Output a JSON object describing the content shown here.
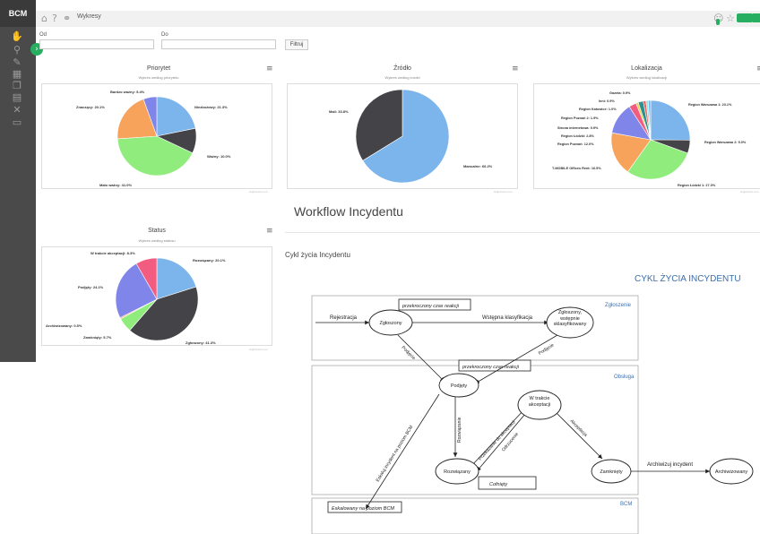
{
  "app": {
    "logo": "BCM"
  },
  "topbar": {
    "breadcrumb": "Wykresy"
  },
  "filters": {
    "from_label": "Od",
    "to_label": "Do",
    "filter_button": "Filtruj"
  },
  "credit": "Highcharts.com",
  "charts": {
    "priorytet": {
      "title": "Priorytet",
      "subtitle": "Wykres według priorytetu"
    },
    "zrodlo": {
      "title": "Źródło",
      "subtitle": "Wykres według źródeł"
    },
    "lokalizacja": {
      "title": "Lokalizacja",
      "subtitle": "Wykres według lokalizacji"
    },
    "status": {
      "title": "Status",
      "subtitle": "Wykres według statusu"
    }
  },
  "chart_data": [
    {
      "type": "pie",
      "title": "Priorytet",
      "subtitle": "Wykres według priorytetu",
      "series": [
        {
          "name": "Priorytet",
          "values": [
            {
              "label": "Niezbożowy: 21.3%",
              "value": 21.3,
              "color": "#7cb5ec"
            },
            {
              "label": "Ważny: 10.0%",
              "value": 10.0,
              "color": "#434348"
            },
            {
              "label": "Mało ważny: 41.0%",
              "value": 41.0,
              "color": "#90ed7d"
            },
            {
              "label": "Znaczący: 20.1%",
              "value": 20.1,
              "color": "#f7a35c"
            },
            {
              "label": "Bardzo ważny: 5.4%",
              "value": 5.4,
              "color": "#8085e9"
            }
          ]
        }
      ]
    },
    {
      "type": "pie",
      "title": "Źródło",
      "subtitle": "Wykres według źródeł",
      "series": [
        {
          "name": "Źródło",
          "values": [
            {
              "label": "Manualne: 66.2%",
              "value": 66.2,
              "color": "#7cb5ec"
            },
            {
              "label": "Mail: 33.8%",
              "value": 33.8,
              "color": "#434348"
            }
          ]
        }
      ]
    },
    {
      "type": "pie",
      "title": "Lokalizacja",
      "subtitle": "Wykres według lokalizacji",
      "series": [
        {
          "name": "Lokalizacja",
          "values": [
            {
              "label": "Region Warszawa 1: 23.1%",
              "value": 23.1,
              "color": "#7cb5ec"
            },
            {
              "label": "Region Warszawa 2: 5.0%",
              "value": 5.0,
              "color": "#434348"
            },
            {
              "label": "Region Łódzki 1: 27.0%",
              "value": 27.0,
              "color": "#90ed7d"
            },
            {
              "label": "T-MOBILE Offices Rent: 16.5%",
              "value": 16.5,
              "color": "#f7a35c"
            },
            {
              "label": "Region Poznań: 12.0%",
              "value": 12.0,
              "color": "#8085e9"
            },
            {
              "label": "Region Łódzki: 2.8%",
              "value": 2.8,
              "color": "#f15c80"
            },
            {
              "label": "Strona internetowa: 0.9%",
              "value": 0.9,
              "color": "#e4d354"
            },
            {
              "label": "Region Poznań 2: 1.9%",
              "value": 1.9,
              "color": "#2b908f"
            },
            {
              "label": "Region Katowice: 1.0%",
              "value": 1.0,
              "color": "#f45b5b"
            },
            {
              "label": "Inni: 0.9%",
              "value": 0.9,
              "color": "#91e8e1"
            },
            {
              "label": "Gazeta: 0.9%",
              "value": 0.9,
              "color": "#7cb5ec"
            }
          ]
        }
      ]
    },
    {
      "type": "pie",
      "title": "Status",
      "subtitle": "Wykres według statusu",
      "series": [
        {
          "name": "Status",
          "values": [
            {
              "label": "Rozwiązany: 20.1%",
              "value": 20.1,
              "color": "#7cb5ec"
            },
            {
              "label": "Zgłoszony: 41.3%",
              "value": 41.3,
              "color": "#434348"
            },
            {
              "label": "Zamknięty: 5.7%",
              "value": 5.7,
              "color": "#90ed7d"
            },
            {
              "label": "Archiwizowany: 0.5%",
              "value": 0.5,
              "color": "#f7a35c"
            },
            {
              "label": "Podjęty: 24.1%",
              "value": 24.1,
              "color": "#8085e9"
            },
            {
              "label": "W trakcie akceptacji: 8.3%",
              "value": 8.3,
              "color": "#f15c80"
            }
          ]
        }
      ]
    }
  ],
  "workflow": {
    "title": "Workflow Incydentu",
    "subtitle": "Cykl życia Incydentu",
    "diagram_title": "CYKL ŻYCIA INCYDENTU",
    "lanes": {
      "zgloszenie": "Zgłoszenie",
      "obsluga": "Obsługa",
      "bcm": "BCM"
    },
    "states": {
      "zgloszony": "Zgłoszony",
      "zgloszony_wstepnie": "Zgłoszony, wstępnie sklasyfikowany",
      "podjety": "Podjęty",
      "w_trakcie": "W trakcie akceptacji",
      "rozwiazany": "Rozwiązany",
      "zamkniety": "Zamknięty",
      "archiwizowany": "Archiwizowany"
    },
    "transitions": {
      "rejestracja": "Rejestracja",
      "wstepna": "Wstępna klasyfikacja",
      "podjecie1": "Podjęcie",
      "podjecie2": "Podjęcie",
      "rozwiazanie": "Rozwiązanie",
      "przekazanie": "Przekazanie do akceptacji",
      "odrzucenie": "Odrzucenie",
      "akceptacja": "Akceptacja",
      "archiwizuj": "Archiwizuj incydent",
      "eskaluj": "Eskaluj incydent na poziom BCM"
    },
    "notes": {
      "przekroczony1": "przekroczony czas reakcji",
      "przekroczony2": "przekroczony czas reakcji",
      "cofniety": "Cofnięty",
      "eskalowany": "Eskalowany na poziom BCM"
    }
  }
}
